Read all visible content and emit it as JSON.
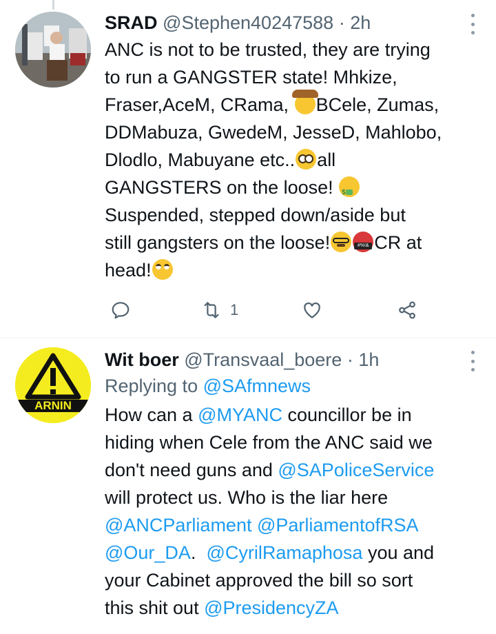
{
  "tweets": [
    {
      "name": "SRAD",
      "handle": "@Stephen40247588",
      "separator": "·",
      "time": "2h",
      "text_lines": [
        "ANC is not to be trusted, they are trying",
        "to run a GANGSTER state! Mhkize,",
        "Fraser,AceM, CRama, ",
        "BCele, Zumas,",
        "DDMabuza, GwedeM, JesseD, Mahlobo,",
        "Dlodlo, Mabuyane etc..",
        "all",
        "GANGSTERS on the loose! ",
        "Suspended, stepped down/aside but",
        "still gangsters on the loose!",
        "CR at",
        "head!"
      ],
      "emojis": [
        "cowboy-emoji",
        "flushed-emoji",
        "money-mouth-emoji",
        "disguise-emoji",
        "cursing-emoji",
        "eye-roll-emoji"
      ],
      "actions": {
        "reply_count": "",
        "retweet_count": "1",
        "like_count": ""
      }
    },
    {
      "name": "Wit boer",
      "handle": "@Transvaal_boere",
      "separator": "·",
      "time": "1h",
      "replying_prefix": "Replying to ",
      "replying_to": "@SAfmnews",
      "text": {
        "l1a": "How can a ",
        "m1": "@MYANC",
        "l1b": " councillor be in",
        "l2": "hiding when Cele from the ANC said we",
        "l3a": "don't need guns and ",
        "m2": "@SAPoliceService",
        "l4": "will protect us. Who is the liar here",
        "m3": "@ANCParliament",
        "sp": " ",
        "m4": "@ParliamentofRSA",
        "m5": "@Our_DA",
        "l6a": ".  ",
        "m6": "@CyrilRamaphosa",
        "l6b": " you and",
        "l7": "your Cabinet approved the bill so sort",
        "l8a": "this shit out ",
        "m7": "@PresidencyZA"
      },
      "avatar_text": "ARNIN"
    }
  ],
  "colors": {
    "link": "#1d9bf0",
    "secondary_text": "#536471",
    "primary_text": "#0f1419",
    "warning_yellow": "#f4ec1f"
  }
}
